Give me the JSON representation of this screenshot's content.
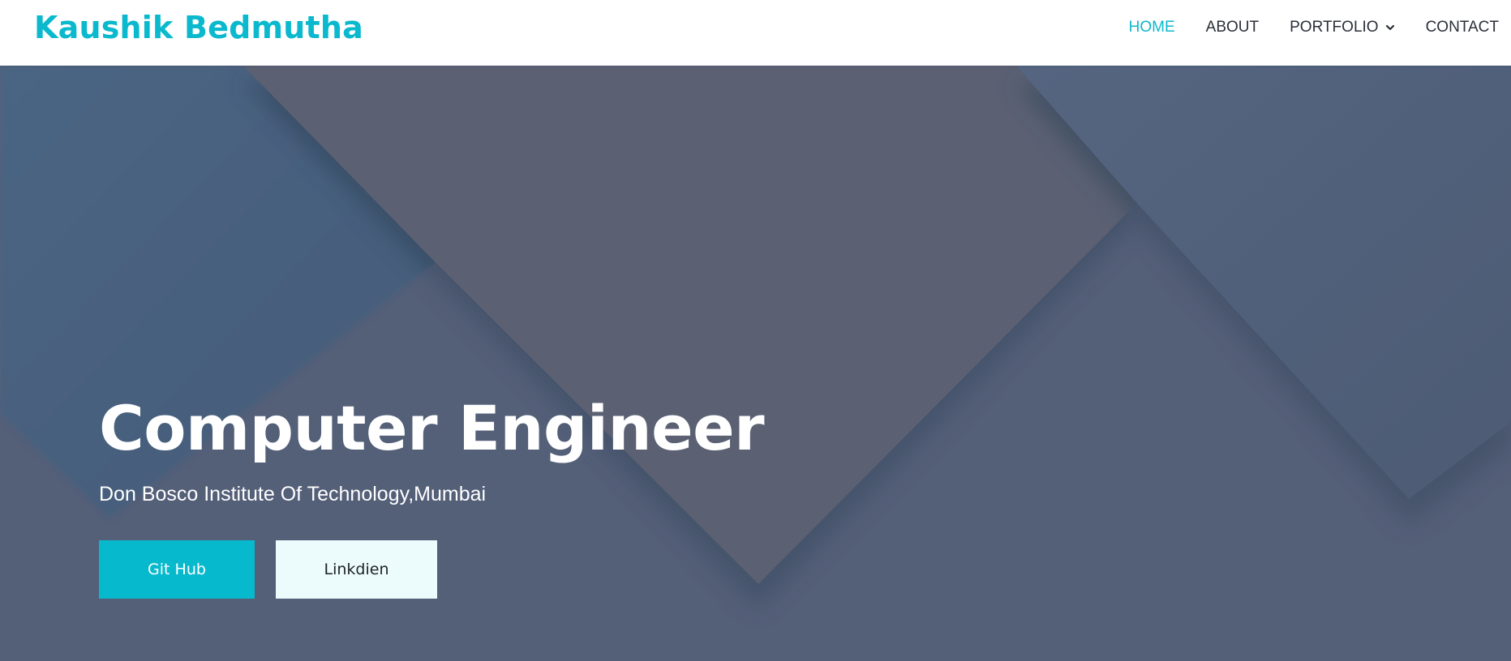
{
  "brand": {
    "name": "Kaushik Bedmutha",
    "color": "#0ab9cd"
  },
  "nav": {
    "items": [
      {
        "label": "HOME",
        "active": true
      },
      {
        "label": "ABOUT",
        "active": false
      },
      {
        "label": "PORTFOLIO",
        "active": false,
        "icon": "chevron-down-icon"
      },
      {
        "label": "CONTACT",
        "active": false
      }
    ]
  },
  "hero": {
    "title": "Computer Engineer",
    "subtitle": "Don Bosco Institute Of Technology,Mumbai",
    "buttons": {
      "primary": "Git Hub",
      "secondary": "Linkdien"
    }
  },
  "colors": {
    "accent": "#0ab9cd",
    "hero_overlay": "#56627a",
    "secondary_button": "#ecfbfc"
  }
}
